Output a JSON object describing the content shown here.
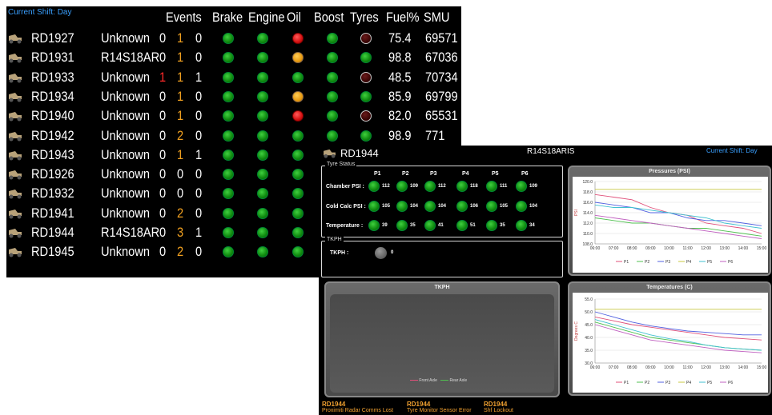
{
  "fleet": {
    "current_shift": "Current Shift: Day",
    "headers": [
      "Events",
      "Brake",
      "Engine",
      "Oil",
      "Boost",
      "Tyres",
      "Fuel%",
      "SMU"
    ],
    "rows": [
      {
        "unit": "RD1927",
        "name": "Unknown",
        "e1": "0",
        "e2": "1",
        "e3": "0",
        "brake": "g",
        "engine": "g",
        "oil": "r",
        "boost": "g",
        "tyres": "d",
        "fuel": "75.4",
        "smu": "69571"
      },
      {
        "unit": "RD1931",
        "name": "R14S18AR",
        "e1": "0",
        "e2": "1",
        "e3": "0",
        "brake": "g",
        "engine": "g",
        "oil": "o",
        "boost": "g",
        "tyres": "g",
        "fuel": "98.8",
        "smu": "67036"
      },
      {
        "unit": "RD1933",
        "name": "Unknown",
        "e1": "1",
        "e2": "1",
        "e3": "1",
        "brake": "g",
        "engine": "g",
        "oil": "g",
        "boost": "g",
        "tyres": "d",
        "fuel": "48.5",
        "smu": "70734"
      },
      {
        "unit": "RD1934",
        "name": "Unknown",
        "e1": "0",
        "e2": "1",
        "e3": "0",
        "brake": "g",
        "engine": "g",
        "oil": "o",
        "boost": "g",
        "tyres": "g",
        "fuel": "85.9",
        "smu": "69799"
      },
      {
        "unit": "RD1940",
        "name": "Unknown",
        "e1": "0",
        "e2": "1",
        "e3": "0",
        "brake": "g",
        "engine": "g",
        "oil": "r",
        "boost": "g",
        "tyres": "d",
        "fuel": "82.0",
        "smu": "65531"
      },
      {
        "unit": "RD1942",
        "name": "Unknown",
        "e1": "0",
        "e2": "2",
        "e3": "0",
        "brake": "g",
        "engine": "g",
        "oil": "g",
        "boost": "g",
        "tyres": "g",
        "fuel": "98.9",
        "smu": "771"
      },
      {
        "unit": "RD1943",
        "name": "Unknown",
        "e1": "0",
        "e2": "1",
        "e3": "1",
        "brake": "g",
        "engine": "g",
        "oil": "g",
        "boost": "",
        "tyres": "",
        "fuel": "",
        "smu": ""
      },
      {
        "unit": "RD1926",
        "name": "Unknown",
        "e1": "0",
        "e2": "0",
        "e3": "0",
        "brake": "g",
        "engine": "g",
        "oil": "g",
        "boost": "",
        "tyres": "",
        "fuel": "",
        "smu": ""
      },
      {
        "unit": "RD1932",
        "name": "Unknown",
        "e1": "0",
        "e2": "0",
        "e3": "0",
        "brake": "g",
        "engine": "g",
        "oil": "g",
        "boost": "",
        "tyres": "",
        "fuel": "",
        "smu": ""
      },
      {
        "unit": "RD1941",
        "name": "Unknown",
        "e1": "0",
        "e2": "2",
        "e3": "0",
        "brake": "g",
        "engine": "g",
        "oil": "g",
        "boost": "",
        "tyres": "",
        "fuel": "",
        "smu": ""
      },
      {
        "unit": "RD1944",
        "name": "R14S18AR",
        "e1": "0",
        "e2": "3",
        "e3": "1",
        "brake": "g",
        "engine": "g",
        "oil": "g",
        "boost": "",
        "tyres": "",
        "fuel": "",
        "smu": ""
      },
      {
        "unit": "RD1945",
        "name": "Unknown",
        "e1": "0",
        "e2": "2",
        "e3": "0",
        "brake": "g",
        "engine": "g",
        "oil": "g",
        "boost": "",
        "tyres": "",
        "fuel": "",
        "smu": ""
      }
    ],
    "colors": {
      "event_red": "#ff2a2a",
      "event_orange": "#f0a020",
      "shift_blue": "#3aa0ff"
    }
  },
  "detail": {
    "unit": "RD1944",
    "name": "R14S18ARIS",
    "current_shift": "Current Shift: Day",
    "tyre_status_label": "Tyre Status",
    "tyre_positions": [
      "P1",
      "P2",
      "P3",
      "P4",
      "P5",
      "P6"
    ],
    "tyre_rows": [
      {
        "label": "Chamber PSI :",
        "values": [
          "112",
          "109",
          "112",
          "118",
          "111",
          "109"
        ]
      },
      {
        "label": "Cold Calc PSI :",
        "values": [
          "105",
          "104",
          "104",
          "106",
          "105",
          "104"
        ]
      },
      {
        "label": "Temperature :",
        "values": [
          "39",
          "35",
          "41",
          "51",
          "35",
          "34"
        ]
      }
    ],
    "tkph_box_label": "TKPH",
    "tkph_label": "TKPH :",
    "tkph_value": "0",
    "tkph_panel_title": "TKPH",
    "tkph_legend": [
      "Front Axle",
      "Rear Axle"
    ],
    "alerts": [
      {
        "unit": "RD1944",
        "message": "Proximiti Radar Comms Lost"
      },
      {
        "unit": "RD1944",
        "message": "Tyre Monitor Sensor Error"
      },
      {
        "unit": "RD1944",
        "message": "Shf Lockout"
      }
    ]
  },
  "chart_data": [
    {
      "type": "line",
      "title": "Pressures (PSI)",
      "ylabel": "PSI",
      "ylim": [
        108.0,
        120.0
      ],
      "yticks": [
        "120.0",
        "118.0",
        "116.0",
        "114.0",
        "112.0",
        "110.0",
        "108.0"
      ],
      "x": [
        "06:00",
        "07:00",
        "08:00",
        "09:00",
        "10:00",
        "11:00",
        "12:00",
        "13:00",
        "14:00",
        "15:00"
      ],
      "series": [
        {
          "name": "P1",
          "color": "#e0507a",
          "values": [
            117.5,
            117.0,
            116.5,
            115.0,
            114.0,
            113.5,
            112.0,
            111.5,
            111.0,
            110.0
          ]
        },
        {
          "name": "P2",
          "color": "#50c050",
          "values": [
            113.0,
            112.5,
            112.0,
            112.0,
            111.5,
            111.0,
            111.0,
            110.5,
            110.0,
            109.5
          ]
        },
        {
          "name": "P3",
          "color": "#5060e0",
          "values": [
            116.0,
            115.5,
            115.0,
            114.0,
            114.0,
            113.0,
            112.5,
            112.5,
            112.0,
            111.5
          ]
        },
        {
          "name": "P4",
          "color": "#c8c840",
          "values": [
            118.5,
            118.5,
            118.5,
            118.5,
            118.5,
            118.5,
            118.5,
            118.5,
            118.5,
            118.5
          ]
        },
        {
          "name": "P5",
          "color": "#40c0d0",
          "values": [
            115.5,
            115.0,
            115.0,
            114.5,
            114.0,
            113.5,
            113.0,
            112.0,
            111.5,
            111.0
          ]
        },
        {
          "name": "P6",
          "color": "#c060c0",
          "values": [
            113.5,
            113.0,
            112.5,
            112.0,
            111.5,
            111.0,
            110.5,
            110.0,
            109.5,
            109.0
          ]
        }
      ]
    },
    {
      "type": "line",
      "title": "Temperatures (C)",
      "ylabel": "Degrees C",
      "ylim": [
        30.0,
        55.0
      ],
      "yticks": [
        "55.0",
        "50.0",
        "45.0",
        "40.0",
        "35.0",
        "30.0"
      ],
      "x": [
        "06:00",
        "07:00",
        "08:00",
        "09:00",
        "10:00",
        "11:00",
        "12:00",
        "13:00",
        "14:00",
        "15:00"
      ],
      "series": [
        {
          "name": "P1",
          "color": "#e0507a",
          "values": [
            48.0,
            46.5,
            45.0,
            44.0,
            43.0,
            42.0,
            41.0,
            40.0,
            39.5,
            39.0
          ]
        },
        {
          "name": "P2",
          "color": "#50c050",
          "values": [
            46.0,
            44.0,
            42.0,
            40.0,
            39.0,
            38.0,
            37.0,
            36.0,
            35.5,
            35.0
          ]
        },
        {
          "name": "P3",
          "color": "#5060e0",
          "values": [
            50.0,
            48.0,
            46.0,
            44.5,
            43.5,
            42.5,
            42.0,
            41.5,
            41.0,
            41.0
          ]
        },
        {
          "name": "P4",
          "color": "#c8c840",
          "values": [
            51.0,
            51.0,
            51.0,
            51.0,
            51.0,
            51.0,
            51.0,
            51.0,
            51.0,
            51.0
          ]
        },
        {
          "name": "P5",
          "color": "#40c0d0",
          "values": [
            47.0,
            45.0,
            43.0,
            41.0,
            39.5,
            38.5,
            37.0,
            36.0,
            35.5,
            35.0
          ]
        },
        {
          "name": "P6",
          "color": "#c060c0",
          "values": [
            45.0,
            43.0,
            41.0,
            39.0,
            38.0,
            37.0,
            36.0,
            35.0,
            34.5,
            34.0
          ]
        }
      ]
    }
  ]
}
